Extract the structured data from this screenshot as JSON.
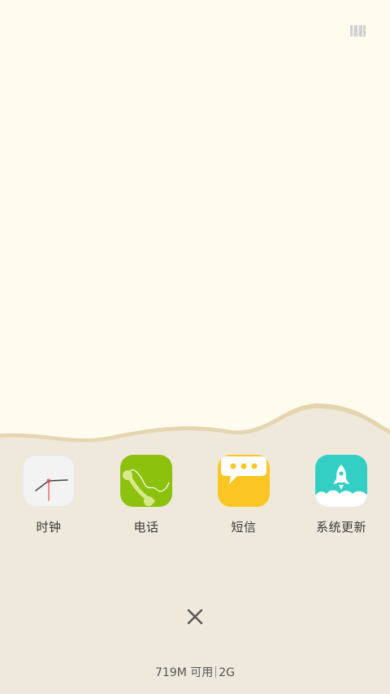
{
  "apps": [
    {
      "label": "时钟",
      "icon": "clock-icon"
    },
    {
      "label": "电话",
      "icon": "phone-icon"
    },
    {
      "label": "短信",
      "icon": "message-icon"
    },
    {
      "label": "系统更新",
      "icon": "rocket-icon"
    }
  ],
  "status": {
    "memory": "719M 可用",
    "total": "2G"
  },
  "colors": {
    "background_top": "#fefcee",
    "background_bottom": "#efe9dc",
    "wave_edge": "#e8d9b8",
    "phone_green": "#8cc10e",
    "message_yellow": "#fbc623",
    "update_teal": "#34cfc4"
  }
}
